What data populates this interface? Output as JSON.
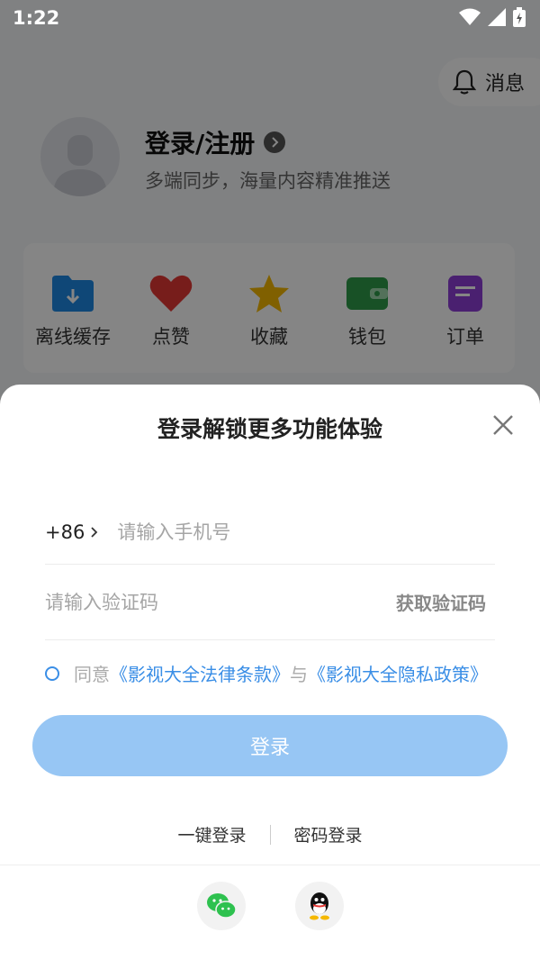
{
  "status_bar": {
    "time": "1:22"
  },
  "header": {
    "message_label": "消息"
  },
  "profile": {
    "title": "登录/注册",
    "subtitle": "多端同步，海量内容精准推送"
  },
  "functions": [
    {
      "label": "离线缓存",
      "icon": "download-folder-icon"
    },
    {
      "label": "点赞",
      "icon": "heart-icon"
    },
    {
      "label": "收藏",
      "icon": "star-icon"
    },
    {
      "label": "钱包",
      "icon": "wallet-icon"
    },
    {
      "label": "订单",
      "icon": "order-icon"
    }
  ],
  "login_sheet": {
    "title": "登录解锁更多功能体验",
    "country_code": "+86",
    "phone_placeholder": "请输入手机号",
    "code_placeholder": "请输入验证码",
    "get_code_label": "获取验证码",
    "agree_prefix": "同意",
    "terms_link": "《影视大全法律条款》",
    "and_text": "与",
    "privacy_link": "《影视大全隐私政策》",
    "login_button": "登录",
    "one_key_login": "一键登录",
    "password_login": "密码登录"
  },
  "colors": {
    "accent": "#3a8ee6",
    "login_button": "#97c6f4"
  }
}
